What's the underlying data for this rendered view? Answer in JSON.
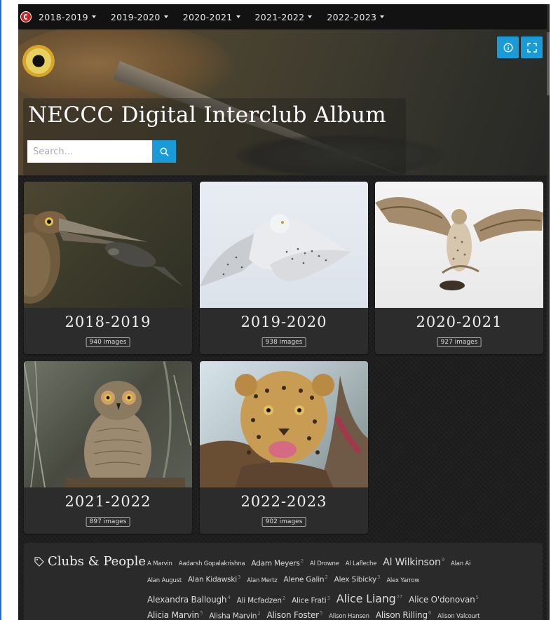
{
  "nav": {
    "items": [
      {
        "label": "2018-2019"
      },
      {
        "label": "2019-2020"
      },
      {
        "label": "2020-2021"
      },
      {
        "label": "2021-2022"
      },
      {
        "label": "2022-2023"
      }
    ]
  },
  "hero": {
    "title": "NECCC Digital Interclub Album",
    "search_placeholder": "Search..."
  },
  "albums": [
    {
      "title": "2018-2019",
      "count": "940 images"
    },
    {
      "title": "2019-2020",
      "count": "938 images"
    },
    {
      "title": "2020-2021",
      "count": "927 images"
    },
    {
      "title": "2021-2022",
      "count": "897 images"
    },
    {
      "title": "2022-2023",
      "count": "902 images"
    }
  ],
  "tags": {
    "heading": "Clubs & People",
    "lines": [
      [
        {
          "name": "A Marvin",
          "count": "",
          "size": "sm"
        },
        {
          "name": "Aadarsh Gopalakrishna",
          "count": "",
          "size": "sm"
        },
        {
          "name": "Adam Meyers",
          "count": "2",
          "size": "md"
        },
        {
          "name": "Al Drowne",
          "count": "",
          "size": "sm"
        },
        {
          "name": "Al Lafleche",
          "count": "",
          "size": "sm"
        },
        {
          "name": "Al Wilkinson",
          "count": "9",
          "size": "lg"
        },
        {
          "name": "Alan Ai",
          "count": "",
          "size": "sm"
        }
      ],
      [
        {
          "name": "Alan August",
          "count": "",
          "size": "sm"
        },
        {
          "name": "Alan Kidawski",
          "count": "3",
          "size": "md"
        },
        {
          "name": "Alan Mertz",
          "count": "",
          "size": "sm"
        },
        {
          "name": "Alene Galin",
          "count": "2",
          "size": "md"
        },
        {
          "name": "Alex Sibicky",
          "count": "3",
          "size": "md"
        },
        {
          "name": "Alex Yarrow",
          "count": "",
          "size": "sm"
        }
      ],
      [
        {
          "name": "Alexandra Ballough",
          "count": "4",
          "size": "ml"
        },
        {
          "name": "Ali Mcfadzen",
          "count": "2",
          "size": "md"
        },
        {
          "name": "Alice Frati",
          "count": "3",
          "size": "md"
        },
        {
          "name": "Alice Liang",
          "count": "27",
          "size": "xl"
        },
        {
          "name": "Alice O'donovan",
          "count": "5",
          "size": "ml"
        }
      ],
      [
        {
          "name": "Alicia Marvin",
          "count": "5",
          "size": "ml"
        },
        {
          "name": "Alisha Marvin",
          "count": "2",
          "size": "md"
        },
        {
          "name": "Alison Foster",
          "count": "5",
          "size": "ml"
        },
        {
          "name": "Alison Hansen",
          "count": "",
          "size": "sm"
        },
        {
          "name": "Alison Rilling",
          "count": "6",
          "size": "ml"
        },
        {
          "name": "Alison Valcourt",
          "count": "",
          "size": "sm"
        }
      ]
    ]
  }
}
